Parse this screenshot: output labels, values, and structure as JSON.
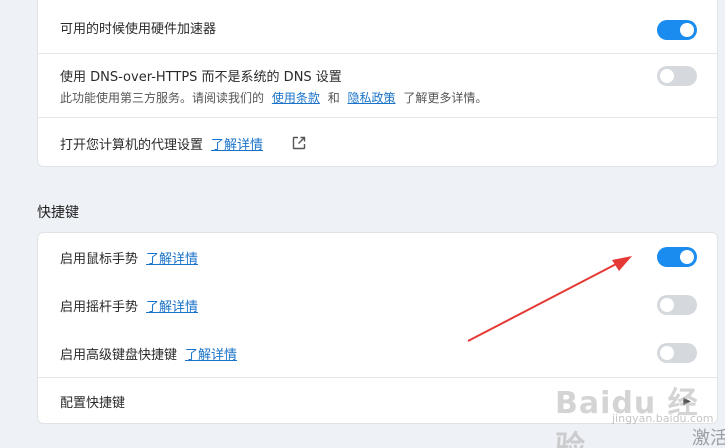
{
  "top_section": {
    "hw_accel": {
      "label": "可用的时候使用硬件加速器",
      "enabled": true
    },
    "dns": {
      "label": "使用 DNS-over-HTTPS 而不是系统的 DNS 设置",
      "desc_prefix": "此功能使用第三方服务。请阅读我们的",
      "terms_link": "使用条款",
      "and": "和",
      "privacy_link": "隐私政策",
      "desc_suffix": "了解更多详情。",
      "enabled": false
    },
    "proxy": {
      "label": "打开您计算机的代理设置",
      "link": "了解详情",
      "icon": "external-link-icon"
    }
  },
  "shortcuts": {
    "title": "快捷键",
    "mouse_gestures": {
      "label": "启用鼠标手势",
      "link": "了解详情",
      "enabled": true
    },
    "rocker_gestures": {
      "label": "启用摇杆手势",
      "link": "了解详情",
      "enabled": false
    },
    "advanced_keyboard": {
      "label": "启用高级键盘快捷键",
      "link": "了解详情",
      "enabled": false
    },
    "configure": {
      "label": "配置快捷键",
      "icon": "chevron-right-icon"
    }
  },
  "watermark": {
    "brand": "Baidu 经验",
    "sub": "jingyan.baidu.com"
  },
  "corner_text": "激活",
  "colors": {
    "toggle_on": "#1a8cf0",
    "toggle_off": "#d5d8dd",
    "link": "#1a73c8",
    "arrow": "#e53935"
  }
}
